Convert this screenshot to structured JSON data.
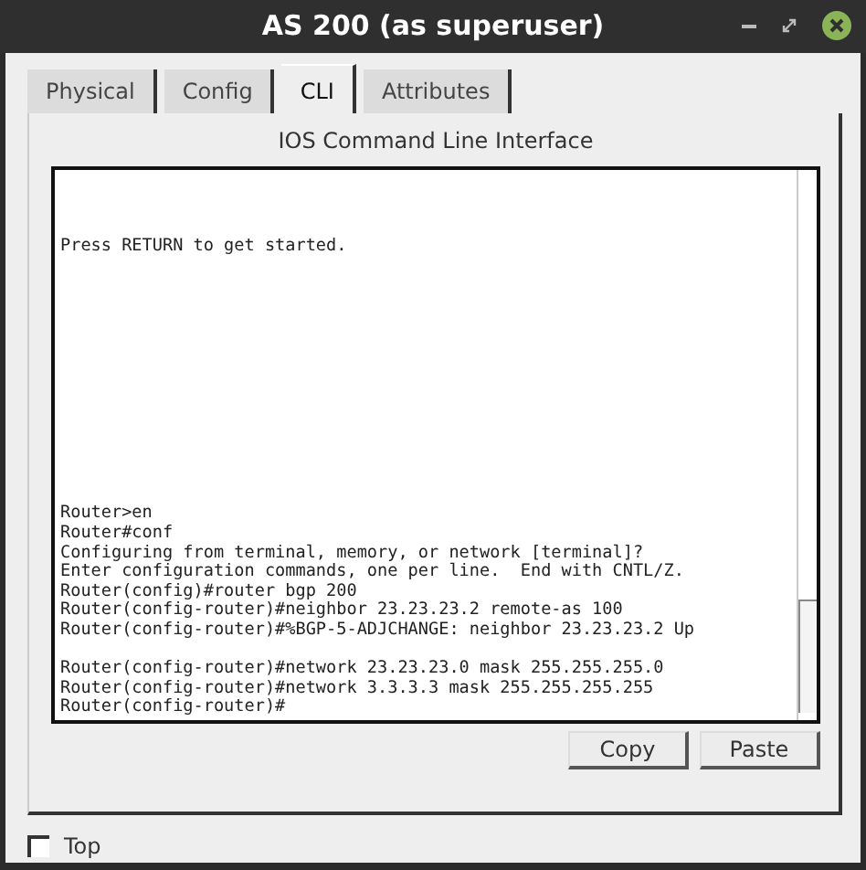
{
  "window": {
    "title": "AS 200 (as superuser)"
  },
  "tabs": [
    {
      "label": "Physical",
      "selected": false
    },
    {
      "label": "Config",
      "selected": false
    },
    {
      "label": "CLI",
      "selected": true
    },
    {
      "label": "Attributes",
      "selected": false
    }
  ],
  "panel_title": "IOS Command Line Interface",
  "terminal": {
    "banner": "Press RETURN to get started.",
    "blocks": [
      [
        "Router>en",
        "Router#conf",
        "Configuring from terminal, memory, or network [terminal]?",
        "Enter configuration commands, one per line.  End with CNTL/Z.",
        "Router(config)#router bgp 200",
        "Router(config-router)#neighbor 23.23.23.2 remote-as 100",
        "Router(config-router)#%BGP-5-ADJCHANGE: neighbor 23.23.23.2 Up"
      ],
      [
        "Router(config-router)#network 23.23.23.0 mask 255.255.255.0",
        "Router(config-router)#network 3.3.3.3 mask 255.255.255.255",
        "Router(config-router)#"
      ]
    ]
  },
  "buttons": [
    "Copy",
    "Paste"
  ],
  "top_checkbox": {
    "label": "Top",
    "checked": false
  }
}
